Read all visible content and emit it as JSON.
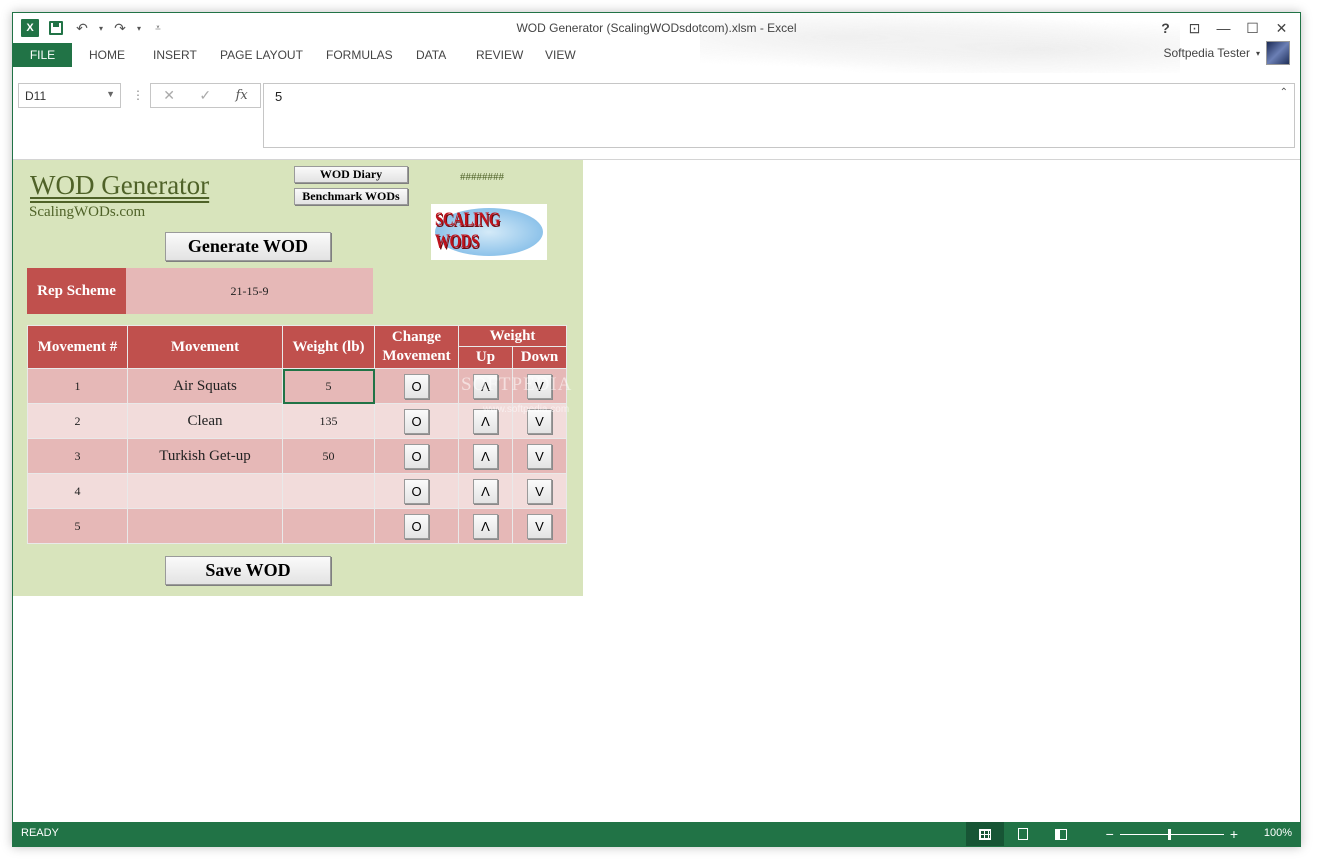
{
  "window": {
    "title": "WOD Generator (ScalingWODsdotcom).xlsm - Excel"
  },
  "qat": {
    "app_icon": "excel-icon",
    "save_icon": "save-icon",
    "undo_icon": "undo-icon",
    "redo_icon": "redo-icon",
    "customize_icon": "customize-qat-icon"
  },
  "window_controls": {
    "help": "?",
    "ribbon_display": "⊡",
    "minimize": "—",
    "maximize": "☐",
    "close": "✕"
  },
  "ribbon": {
    "tabs": [
      "FILE",
      "HOME",
      "INSERT",
      "PAGE LAYOUT",
      "FORMULAS",
      "DATA",
      "REVIEW",
      "VIEW"
    ],
    "user_name": "Softpedia Tester"
  },
  "formula_bar": {
    "name_box": "D11",
    "formula_value": "5",
    "fx_label": "fx"
  },
  "sheet": {
    "title": "WOD Generator",
    "subtitle": "ScalingWODs.com",
    "diary_button": "WOD Diary",
    "benchmark_button": "Benchmark WODs",
    "hashes": "########",
    "logo_text": "SCALING WODS",
    "generate_button": "Generate WOD",
    "save_button": "Save WOD",
    "rep_scheme_label": "Rep Scheme",
    "rep_scheme_value": "21-15-9",
    "headers": {
      "movement_num": "Movement #",
      "movement": "Movement",
      "weight": "Weight (lb)",
      "change_line1": "Change",
      "change_line2": "Movement",
      "weight_group": "Weight",
      "up": "Up",
      "down": "Down"
    },
    "rows": [
      {
        "num": "1",
        "movement": "Air Squats",
        "weight": "5",
        "change": "O",
        "up": "Λ",
        "down": "V"
      },
      {
        "num": "2",
        "movement": "Clean",
        "weight": "135",
        "change": "O",
        "up": "Λ",
        "down": "V"
      },
      {
        "num": "3",
        "movement": "Turkish Get-up",
        "weight": "50",
        "change": "O",
        "up": "Λ",
        "down": "V"
      },
      {
        "num": "4",
        "movement": "",
        "weight": "",
        "change": "O",
        "up": "Λ",
        "down": "V"
      },
      {
        "num": "5",
        "movement": "",
        "weight": "",
        "change": "O",
        "up": "Λ",
        "down": "V"
      }
    ],
    "watermark": "SOFTPEDIA",
    "watermark_url": "www.softpedia.com"
  },
  "status": {
    "text": "READY",
    "zoom": "100%",
    "zoom_fraction": 0.5
  },
  "colors": {
    "excel_green": "#217346",
    "panel_green": "#d8e4bc",
    "header_red": "#c0504d",
    "row_pink_dark": "#e6b8b7",
    "row_pink_light": "#f2dcdb",
    "title_olive": "#4f6228"
  }
}
